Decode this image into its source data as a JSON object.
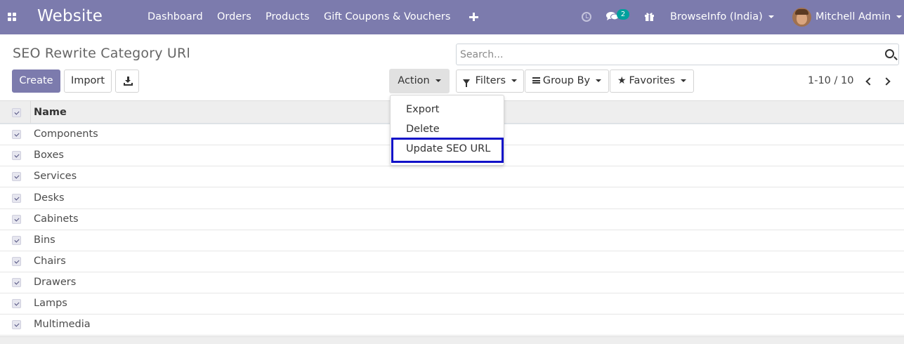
{
  "navbar": {
    "brand": "Website",
    "menu": [
      "Dashboard",
      "Orders",
      "Products",
      "Gift Coupons & Vouchers"
    ],
    "chat_count": "2",
    "company": "BrowseInfo (India)",
    "user": "Mitchell Admin",
    "accent_color": "#7c7bad"
  },
  "page": {
    "title": "SEO Rewrite Category URl"
  },
  "search": {
    "placeholder": "Search..."
  },
  "toolbar": {
    "create_label": "Create",
    "import_label": "Import",
    "action_label": "Action",
    "filters_label": "Filters",
    "groupby_label": "Group By",
    "favorites_label": "Favorites"
  },
  "pager": {
    "text": "1-10 / 10"
  },
  "action_menu": {
    "items": [
      "Export",
      "Delete",
      "Update SEO URL"
    ],
    "highlighted": "Update SEO URL"
  },
  "table": {
    "columns": [
      "Name"
    ],
    "rows": [
      "Components",
      "Boxes",
      "Services",
      "Desks",
      "Cabinets",
      "Bins",
      "Chairs",
      "Drawers",
      "Lamps",
      "Multimedia"
    ],
    "all_selected": true
  }
}
